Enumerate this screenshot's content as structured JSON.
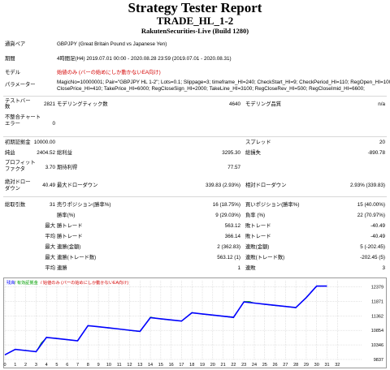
{
  "header": {
    "title": "Strategy Tester Report",
    "expert": "TRADE_HL_1-2",
    "server": "RakutenSecurities-Live (Build 1280)"
  },
  "info": {
    "symbol_label": "通貨ペア",
    "symbol_value": "GBPJPY (Great Britain Pound vs Japanese Yen)",
    "period_label": "期間",
    "period_value": "4時間足(H4) 2019.07.01 00:00 - 2020.08.28 23:59 (2019.07.01 - 2020.08.31)",
    "model_label": "モデル",
    "model_value": "始値のみ (バーの始めにしか動かないEA向け)",
    "params_label": "パラメーター",
    "params_line1": "MagicNo=10000001; Pair=\"GBPJPY HL 1-2\"; Lots=0.1; Slippage=3; timeframe_HI=240; CheckStart_HI=9; CheckPeriod_HI=110; RegOpen_HI=100;",
    "params_line2": "ClosePrice_HI=410; TakePrice_HI=6000; RegCloseSign_HI=2000; TakeLine_HI=3100; RegCloseRev_HI=500; RegCloseImid_HI=6600;"
  },
  "stats1": {
    "bars_label": "テストバー数",
    "bars_value": "2821",
    "ticks_label": "モデリングティック数",
    "ticks_value": "4640",
    "quality_label": "モデリング品質",
    "quality_value": "n/a",
    "mismatch_label": "不整合チャートエラー",
    "mismatch_value": "0"
  },
  "stats2": {
    "deposit_label": "初期証拠金",
    "deposit_value": "10000.00",
    "spread_label": "スプレッド",
    "spread_value": "20",
    "netprofit_label": "純益",
    "netprofit_value": "2404.52",
    "grossprofit_label": "総利益",
    "grossprofit_value": "3295.30",
    "grossloss_label": "総損失",
    "grossloss_value": "-890.78",
    "pf_label": "プロフィットファクタ",
    "pf_value": "3.70",
    "expected_label": "期待利得",
    "expected_value": "77.57",
    "absdd_label": "絶対ドローダウン",
    "absdd_value": "40.49",
    "maxdd_label": "最大ドローダウン",
    "maxdd_value": "339.83 (2.93%)",
    "reldd_label": "相対ドローダウン",
    "reldd_value": "2.93% (339.83)"
  },
  "stats3": {
    "total_label": "総取引数",
    "total_value": "31",
    "short_label": "売りポジション(勝率%)",
    "short_value": "16 (18.75%)",
    "long_label": "買いポジション(勝率%)",
    "long_value": "15 (40.00%)",
    "win_label": "勝率(%)",
    "win_value": "9 (29.03%)",
    "loss_label": "負率 (%)",
    "loss_value": "22 (70.97%)",
    "max_word": "最大",
    "largest_win_label": "勝トレード",
    "largest_win_value": "563.12",
    "largest_loss_label": "敗トレード",
    "largest_loss_value": "-40.49",
    "avg_word": "平均",
    "avg_win_label": "勝トレード",
    "avg_win_value": "366.14",
    "avg_loss_label": "敗トレード",
    "avg_loss_value": "-40.49",
    "cons_wins_label": "連勝(金額)",
    "cons_wins_value": "2 (362.83)",
    "cons_losses_label": "連敗(金額)",
    "cons_losses_value": "5 (-202.45)",
    "cons_profit_label": "連勝(トレード数)",
    "cons_profit_value": "563.12 (1)",
    "cons_loss_label": "連敗(トレード数)",
    "cons_loss_value": "-202.45 (5)",
    "avg_cons_wins_label": "連勝",
    "avg_cons_wins_value": "1",
    "avg_cons_losses_label": "連敗",
    "avg_cons_losses_value": "3"
  },
  "chart_legend": {
    "balance": "残高",
    "equity": "/ 有効証拠金",
    "note": "/ 始値のみ (バーの始めにしか動かないEA向け)"
  },
  "colors": {
    "balance": "#0000ff",
    "equity": "#00a000",
    "red_text": "#d40000"
  },
  "chart_data": {
    "type": "line",
    "title": "",
    "xlabel": "",
    "ylabel": "",
    "x_ticks": [
      0,
      1,
      2,
      3,
      4,
      5,
      6,
      7,
      8,
      9,
      10,
      11,
      12,
      13,
      14,
      15,
      16,
      17,
      18,
      19,
      20,
      21,
      22,
      23,
      24,
      25,
      26,
      27,
      28,
      29,
      30,
      31,
      32
    ],
    "y_ticks": [
      9837,
      10346,
      10854,
      11362,
      11871,
      12379
    ],
    "xlim": [
      0,
      34.4
    ],
    "ylim": [
      9837,
      12590
    ],
    "series": [
      {
        "key": "balance",
        "x": [
          0,
          1,
          2,
          3,
          4,
          5,
          6,
          7,
          8,
          9,
          10,
          11,
          12,
          13,
          14,
          15,
          16,
          17,
          18,
          19,
          20,
          21,
          22,
          23,
          24,
          25,
          26,
          27,
          28,
          29,
          30,
          31
        ],
        "values": [
          10000,
          10190,
          10150,
          10110,
          10610,
          10570,
          10530,
          10490,
          11020,
          10980,
          10940,
          10900,
          10860,
          10820,
          11300,
          11260,
          11220,
          11180,
          11470,
          11430,
          11390,
          11350,
          11310,
          11850,
          11810,
          11770,
          11730,
          11690,
          11650,
          12000,
          12404,
          12404
        ]
      },
      {
        "key": "equity",
        "x": [
          0,
          1,
          2,
          3,
          3.5,
          4,
          5,
          6,
          7,
          8,
          9,
          10,
          11,
          12,
          13,
          14,
          15,
          16,
          17,
          18,
          19,
          20,
          21,
          22,
          23,
          23.5,
          24,
          25,
          26,
          27,
          28,
          29,
          30,
          31
        ],
        "values": [
          10000,
          10180,
          10160,
          10100,
          10420,
          10600,
          10580,
          10520,
          10490,
          11010,
          10990,
          10930,
          10900,
          10850,
          10810,
          11320,
          11250,
          11210,
          11180,
          11480,
          11420,
          11380,
          11340,
          11300,
          11860,
          11870,
          11810,
          11760,
          11720,
          11690,
          11640,
          12010,
          12404,
          12404
        ]
      }
    ]
  }
}
